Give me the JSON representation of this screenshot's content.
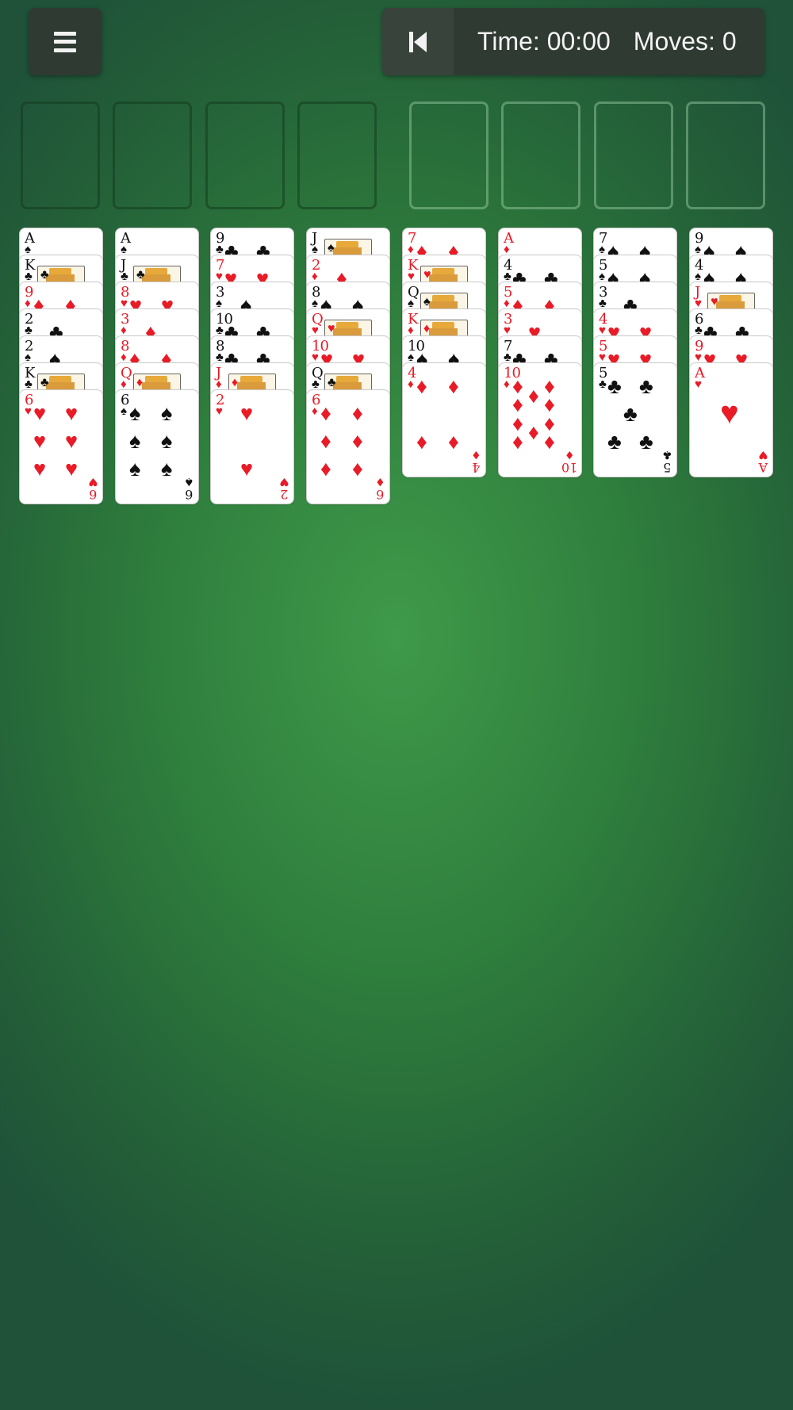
{
  "toolbar": {
    "menu_icon": "menu-icon",
    "undo_icon": "skip-back-icon"
  },
  "status": {
    "time_label": "Time: 00:00",
    "moves_label": "Moves: 0"
  },
  "free_cells": [
    null,
    null,
    null,
    null
  ],
  "foundations": [
    null,
    null,
    null,
    null
  ],
  "colors": {
    "red": "#e81b27",
    "black": "#111111",
    "felt": "#2e7d3c"
  },
  "tableau": [
    [
      {
        "rank": "A",
        "suit": "♠"
      },
      {
        "rank": "K",
        "suit": "♣"
      },
      {
        "rank": "9",
        "suit": "♦"
      },
      {
        "rank": "2",
        "suit": "♣"
      },
      {
        "rank": "2",
        "suit": "♠"
      },
      {
        "rank": "K",
        "suit": "♣"
      },
      {
        "rank": "6",
        "suit": "♥"
      }
    ],
    [
      {
        "rank": "A",
        "suit": "♠"
      },
      {
        "rank": "J",
        "suit": "♣"
      },
      {
        "rank": "8",
        "suit": "♥"
      },
      {
        "rank": "3",
        "suit": "♦"
      },
      {
        "rank": "8",
        "suit": "♦"
      },
      {
        "rank": "Q",
        "suit": "♦"
      },
      {
        "rank": "6",
        "suit": "♠"
      }
    ],
    [
      {
        "rank": "9",
        "suit": "♣"
      },
      {
        "rank": "7",
        "suit": "♥"
      },
      {
        "rank": "3",
        "suit": "♠"
      },
      {
        "rank": "10",
        "suit": "♣"
      },
      {
        "rank": "8",
        "suit": "♣"
      },
      {
        "rank": "J",
        "suit": "♦"
      },
      {
        "rank": "2",
        "suit": "♥"
      }
    ],
    [
      {
        "rank": "J",
        "suit": "♠"
      },
      {
        "rank": "2",
        "suit": "♦"
      },
      {
        "rank": "8",
        "suit": "♠"
      },
      {
        "rank": "Q",
        "suit": "♥"
      },
      {
        "rank": "10",
        "suit": "♥"
      },
      {
        "rank": "Q",
        "suit": "♣"
      },
      {
        "rank": "6",
        "suit": "♦"
      }
    ],
    [
      {
        "rank": "7",
        "suit": "♦"
      },
      {
        "rank": "K",
        "suit": "♥"
      },
      {
        "rank": "Q",
        "suit": "♠"
      },
      {
        "rank": "K",
        "suit": "♦"
      },
      {
        "rank": "10",
        "suit": "♠"
      },
      {
        "rank": "4",
        "suit": "♦"
      }
    ],
    [
      {
        "rank": "A",
        "suit": "♦"
      },
      {
        "rank": "4",
        "suit": "♣"
      },
      {
        "rank": "5",
        "suit": "♦"
      },
      {
        "rank": "3",
        "suit": "♥"
      },
      {
        "rank": "7",
        "suit": "♣"
      },
      {
        "rank": "10",
        "suit": "♦"
      }
    ],
    [
      {
        "rank": "7",
        "suit": "♠"
      },
      {
        "rank": "5",
        "suit": "♠"
      },
      {
        "rank": "3",
        "suit": "♣"
      },
      {
        "rank": "4",
        "suit": "♥"
      },
      {
        "rank": "5",
        "suit": "♥"
      },
      {
        "rank": "5",
        "suit": "♣"
      }
    ],
    [
      {
        "rank": "9",
        "suit": "♠"
      },
      {
        "rank": "4",
        "suit": "♠"
      },
      {
        "rank": "J",
        "suit": "♥"
      },
      {
        "rank": "6",
        "suit": "♣"
      },
      {
        "rank": "9",
        "suit": "♥"
      },
      {
        "rank": "A",
        "suit": "♥"
      }
    ]
  ]
}
